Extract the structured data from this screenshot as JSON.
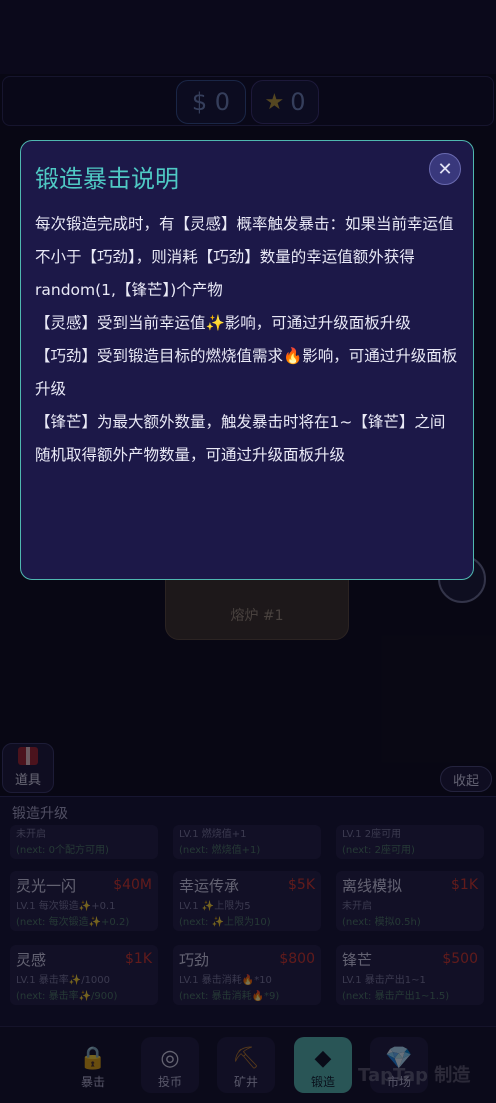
{
  "resources": {
    "money": "$ 0",
    "stars": "0",
    "star_icon": "star-icon"
  },
  "furnace": {
    "label": "熔炉 #1"
  },
  "props": {
    "label": "道具"
  },
  "collapse": {
    "label": "收起"
  },
  "upgrade": {
    "title": "锻造升级",
    "top_row": [
      {
        "lv": "未开启",
        "next": "(next: 0个配方可用)"
      },
      {
        "lv": "LV.1 燃烧值+1",
        "next": "(next: 燃烧值+1)"
      },
      {
        "lv": "LV.1 2座可用",
        "next": "(next: 2座可用)"
      }
    ],
    "row2": [
      {
        "name": "灵光一闪",
        "price": "$40M",
        "lv": "LV.1 每次锻造✨+0.1",
        "next": "(next: 每次锻造✨+0.2)"
      },
      {
        "name": "幸运传承",
        "price": "$5K",
        "lv": "LV.1 ✨上限为5",
        "next": "(next: ✨上限为10)"
      },
      {
        "name": "离线模拟",
        "price": "$1K",
        "lv": "未开启",
        "next": "(next: 模拟0.5h)"
      }
    ],
    "row3": [
      {
        "name": "灵感",
        "price": "$1K",
        "lv": "LV.1 暴击率✨/1000",
        "next": "(next: 暴击率✨/900)"
      },
      {
        "name": "巧劲",
        "price": "$800",
        "lv": "LV.1 暴击消耗🔥*10",
        "next": "(next: 暴击消耗🔥*9)"
      },
      {
        "name": "锋芒",
        "price": "$500",
        "lv": "LV.1 暴击产出1~1",
        "next": "(next: 暴击产出1~1.5)"
      }
    ]
  },
  "nav": [
    {
      "label": "暴击",
      "icon": "lock-icon",
      "glyph": "🔒"
    },
    {
      "label": "投币",
      "icon": "coin-icon",
      "glyph": "◎"
    },
    {
      "label": "矿井",
      "icon": "pickaxe-icon",
      "glyph": "⛏"
    },
    {
      "label": "锻造",
      "icon": "diamond-icon",
      "glyph": "◆"
    },
    {
      "label": "市场",
      "icon": "gem-icon",
      "glyph": "💎"
    }
  ],
  "watermark": "TapTap 制造",
  "modal": {
    "title": "锻造暴击说明",
    "close": "✕",
    "lines": [
      "每次锻造完成时，有【灵感】概率触发暴击：如果当前幸运值不小于【巧劲】，则消耗【巧劲】数量的幸运值额外获得random(1,【锋芒】)个产物",
      "【灵感】受到当前幸运值✨影响，可通过升级面板升级",
      "【巧劲】受到锻造目标的燃烧值需求🔥影响，可通过升级面板升级",
      "【锋芒】为最大额外数量，触发暴击时将在1~【锋芒】之间随机取得额外产物数量，可通过升级面板升级"
    ]
  }
}
